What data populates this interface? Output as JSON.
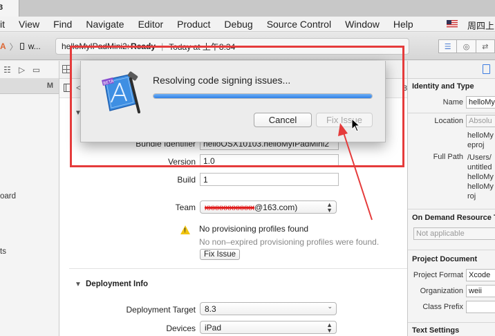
{
  "window_tab": {
    "label": "3"
  },
  "menubar": {
    "items": [
      "it",
      "View",
      "Find",
      "Navigate",
      "Editor",
      "Product",
      "Debug",
      "Source Control",
      "Window",
      "Help"
    ],
    "clock": "周四上"
  },
  "toolbar": {
    "scheme_device": "w...",
    "activity": {
      "project": "helloMyIPadMini2:",
      "status": "Ready",
      "separator": "|",
      "time": "Today at 上午8:34"
    }
  },
  "navigator": {
    "header_badge": "M",
    "fragments": [
      "oard",
      "ts"
    ]
  },
  "subbar": {
    "tail": "3"
  },
  "general": {
    "bundle_identifier": {
      "label": "Bundle Identifier",
      "value": "helloOSX10103.helloMyIPadMini2"
    },
    "version": {
      "label": "Version",
      "value": "1.0"
    },
    "build": {
      "label": "Build",
      "value": "1"
    },
    "team": {
      "label": "Team",
      "redacted": "xxxxxxxxxxxx",
      "suffix": "@163.com)"
    },
    "provisioning": {
      "title": "No provisioning profiles found",
      "detail": "No non–expired provisioning profiles were found.",
      "fix_label": "Fix Issue"
    }
  },
  "deployment": {
    "section_title": "Deployment Info",
    "target": {
      "label": "Deployment Target",
      "value": "8.3"
    },
    "devices": {
      "label": "Devices",
      "value": "iPad"
    }
  },
  "inspector": {
    "identity_title": "Identity and Type",
    "name": {
      "label": "Name",
      "value": "helloMy"
    },
    "location": {
      "label": "Location",
      "value": "Absolu"
    },
    "location_lines": [
      "helloMy",
      "eproj"
    ],
    "full_path": {
      "label": "Full Path",
      "lines": [
        "/Users/",
        "untitled",
        "helloMy",
        "helloMy",
        "roj"
      ]
    },
    "odr_title": "On Demand Resource T",
    "odr_value": "Not applicable",
    "project_doc_title": "Project Document",
    "project_format": {
      "label": "Project Format",
      "value": "Xcode"
    },
    "organization": {
      "label": "Organization",
      "value": "weii"
    },
    "class_prefix": {
      "label": "Class Prefix",
      "value": ""
    },
    "text_settings_title": "Text Settings"
  },
  "sheet": {
    "message": "Resolving code signing issues...",
    "progress": 1.0,
    "cancel_label": "Cancel",
    "fix_label": "Fix Issue",
    "icon_badge": "BETA"
  },
  "colors": {
    "accent": "#2f80e6",
    "annotation": "#e53b3b",
    "warning": "#f1c40f"
  }
}
